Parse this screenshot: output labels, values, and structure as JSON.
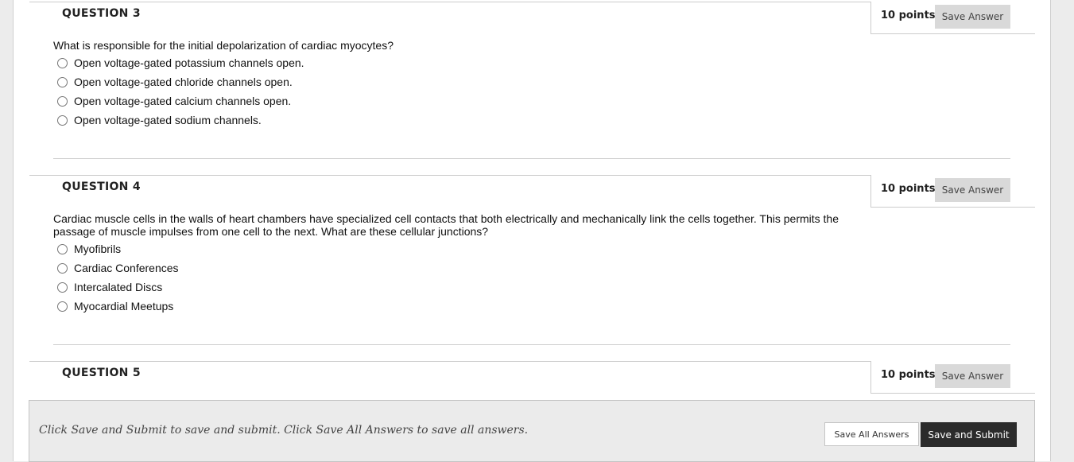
{
  "questions": [
    {
      "title": "QUESTION 3",
      "points": "10 points",
      "save_label": "Save Answer",
      "text": "What is responsible for the initial depolarization of cardiac myocytes?",
      "options": [
        "Open voltage-gated potassium channels open.",
        "Open voltage-gated chloride channels open.",
        "Open voltage-gated calcium channels open.",
        "Open voltage-gated sodium channels."
      ]
    },
    {
      "title": "QUESTION 4",
      "points": "10 points",
      "save_label": "Save Answer",
      "text_lines": [
        "Cardiac muscle cells in the walls of heart chambers have specialized cell contacts that both electrically and mechanically link the cells together. This permits the",
        "passage of muscle impulses from one cell to the next. What are these cellular junctions?"
      ],
      "options": [
        "Myofibrils",
        "Cardiac Conferences",
        "Intercalated Discs",
        "Myocardial Meetups"
      ]
    },
    {
      "title": "QUESTION 5",
      "points": "10 points",
      "save_label": "Save Answer"
    }
  ],
  "footer": {
    "message": "Click Save and Submit to save and submit. Click Save All Answers to save all answers.",
    "save_all_label": "Save All Answers",
    "submit_label": "Save and Submit"
  }
}
